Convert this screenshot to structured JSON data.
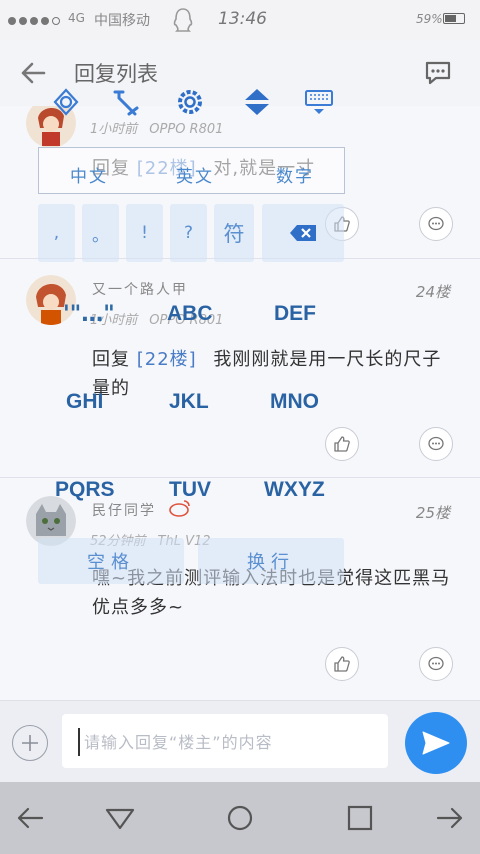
{
  "status_bar": {
    "network": "4G",
    "carrier": "中国移动",
    "time": "13:46",
    "battery": "59%"
  },
  "header": {
    "title": "回复列表",
    "back_icon": "arrow-left-icon",
    "message_icon": "chat-bubble-icon"
  },
  "posts": [
    {
      "time": "1小时前",
      "device": "OPPO R801",
      "body": "对,就是一寸",
      "reply_ref": "[22楼]",
      "reply_prefix": "回复"
    },
    {
      "user": "又一个路人甲",
      "floor": "24楼",
      "time": "1小时前",
      "device": "OPPO R801",
      "reply_prefix": "回复",
      "reply_ref": "[22楼]",
      "body": "我刚刚就是用一尺长的尺子量的"
    },
    {
      "user": "民仔同学",
      "floor": "25楼",
      "time": "52分钟前",
      "device": "ThL V12",
      "body": "嘿~我之前测评输入法时也是觉得这匹黑马优点多多~"
    }
  ],
  "keyboard_overlay": {
    "toolbar_icons": [
      "settings-gear-icon",
      "cursor-move-icon",
      "gear-icon",
      "up-down-arrows-icon",
      "keyboard-hide-icon"
    ],
    "modes": [
      "中文",
      "英文",
      "数字"
    ],
    "punct_keys": [
      ",",
      "。",
      "!",
      "?"
    ],
    "symbol_key": "符",
    "quote_key": "'\"…\"",
    "letter_keys": [
      "ABC",
      "DEF",
      "GHI",
      "JKL",
      "MNO",
      "PQRS",
      "TUV",
      "WXYZ"
    ],
    "space_key": "空格",
    "newline_key": "换行"
  },
  "composer": {
    "placeholder": "请输入回复“楼主”的内容",
    "value": ""
  },
  "colors": {
    "accent": "#2f8ff0",
    "link": "#4a7cc6",
    "keyboard": "#2a63a3"
  }
}
